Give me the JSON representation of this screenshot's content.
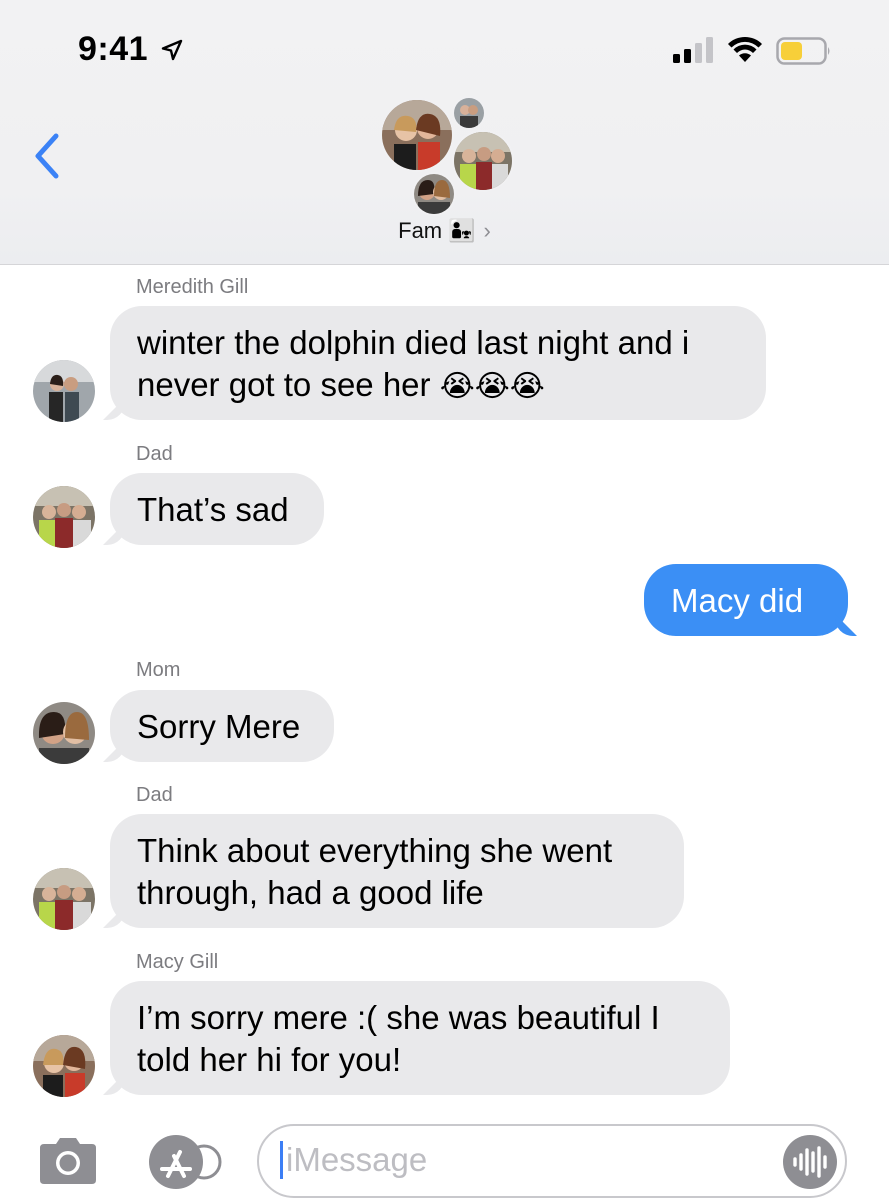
{
  "status_bar": {
    "time": "9:41"
  },
  "header": {
    "group_name": "Fam",
    "group_emoji": "👨‍👧",
    "chevron": "›"
  },
  "icons": {
    "back": "chevron-left-icon",
    "camera": "camera-icon",
    "appstore": "app-store-icon",
    "audio": "audio-waveform-icon"
  },
  "colors": {
    "accent": "#3b8ff5",
    "bubble_gray": "#e9e9eb",
    "battery_fill": "#f7cf39"
  },
  "messages": [
    {
      "sender": "Meredith Gill",
      "text_lines": [
        "winter the dolphin died last night and i",
        "never got to see her"
      ],
      "emojis": "😭😭😭"
    },
    {
      "sender": "Dad",
      "text": "That’s sad"
    },
    {
      "sender": "me",
      "text": "Macy did"
    },
    {
      "sender": "Mom",
      "text": "Sorry Mere"
    },
    {
      "sender": "Dad",
      "text_lines": [
        "Think about everything she went",
        "through, had a good life"
      ]
    },
    {
      "sender": "Macy Gill",
      "text_lines": [
        "I’m sorry mere :( she was beautiful I",
        "told her hi for you!"
      ]
    }
  ],
  "input": {
    "placeholder": "iMessage"
  }
}
